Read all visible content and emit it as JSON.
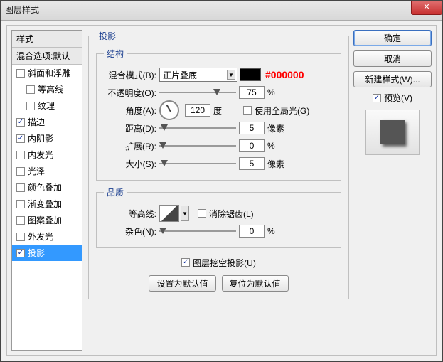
{
  "window": {
    "title": "图层样式"
  },
  "sidebar": {
    "header1": "样式",
    "header2": "混合选项:默认",
    "items": [
      {
        "label": "斜面和浮雕",
        "checked": false,
        "sub": false
      },
      {
        "label": "等高线",
        "checked": false,
        "sub": true
      },
      {
        "label": "纹理",
        "checked": false,
        "sub": true
      },
      {
        "label": "描边",
        "checked": true,
        "sub": false
      },
      {
        "label": "内阴影",
        "checked": true,
        "sub": false
      },
      {
        "label": "内发光",
        "checked": false,
        "sub": false
      },
      {
        "label": "光泽",
        "checked": false,
        "sub": false
      },
      {
        "label": "颜色叠加",
        "checked": false,
        "sub": false
      },
      {
        "label": "渐变叠加",
        "checked": false,
        "sub": false
      },
      {
        "label": "图案叠加",
        "checked": false,
        "sub": false
      },
      {
        "label": "外发光",
        "checked": false,
        "sub": false
      },
      {
        "label": "投影",
        "checked": true,
        "sub": false,
        "selected": true
      }
    ]
  },
  "main": {
    "group_title": "投影",
    "structure": {
      "legend": "结构",
      "blend_label": "混合模式(B):",
      "blend_value": "正片叠底",
      "color_annot": "#000000",
      "opacity_label": "不透明度(O):",
      "opacity_value": "75",
      "opacity_unit": "%",
      "angle_label": "角度(A):",
      "angle_value": "120",
      "angle_unit": "度",
      "global_light": "使用全局光(G)",
      "distance_label": "距离(D):",
      "distance_value": "5",
      "distance_unit": "像素",
      "spread_label": "扩展(R):",
      "spread_value": "0",
      "spread_unit": "%",
      "size_label": "大小(S):",
      "size_value": "5",
      "size_unit": "像素"
    },
    "quality": {
      "legend": "品质",
      "contour_label": "等高线:",
      "antialias": "消除锯齿(L)",
      "noise_label": "杂色(N):",
      "noise_value": "0",
      "noise_unit": "%"
    },
    "knockout": "图层挖空投影(U)",
    "btn_default": "设置为默认值",
    "btn_reset": "复位为默认值"
  },
  "right": {
    "ok": "确定",
    "cancel": "取消",
    "newstyle": "新建样式(W)...",
    "preview": "预览(V)"
  }
}
